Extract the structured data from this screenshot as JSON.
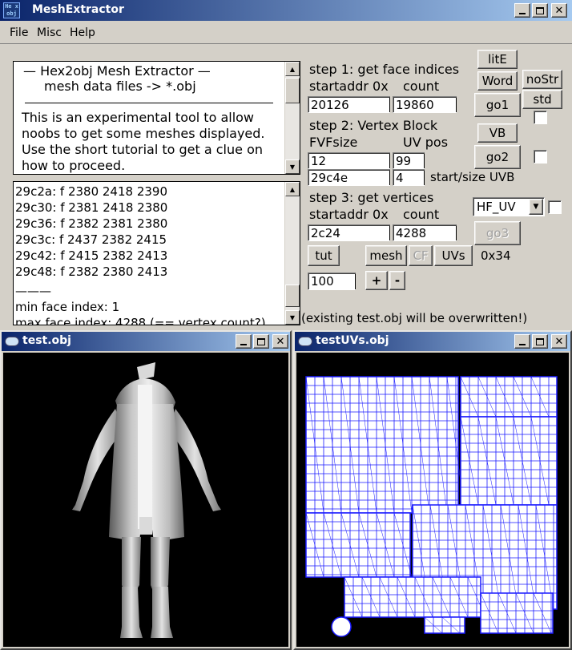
{
  "window": {
    "title": "MeshExtractor",
    "app_icon_text": "He x obj"
  },
  "menu": [
    "File",
    "Misc",
    "Help"
  ],
  "info_text": {
    "line1": "—   Hex2obj Mesh Extractor   —",
    "line2": "mesh data files -> *.obj",
    "para": [
      "This is an experimental tool to allow",
      "noobs to get some meshes displayed.",
      "Use the short tutorial to get a clue on",
      "how to proceed."
    ]
  },
  "log": {
    "lines": [
      "29c2a: f  2380 2418 2390",
      "29c30: f  2381 2418 2380",
      "29c36: f  2382 2381 2380",
      "29c3c: f  2437 2382 2415",
      "29c42: f  2415 2382 2413",
      "29c48: f  2382 2380 2413"
    ],
    "separator": "———",
    "summary": [
      "min face index: 1",
      "max face index: 4288 (== vertex count?)"
    ]
  },
  "step1": {
    "title": "step 1: get face indices",
    "addr_label": "startaddr 0x",
    "count_label": "count",
    "addr_value": "20126",
    "count_value": "19860"
  },
  "step2": {
    "title": "step 2: Vertex Block",
    "fvf_label": "FVFsize",
    "uv_label": "UV pos",
    "fvf_value": "12",
    "uv_value": "99",
    "uvb_start": "29c4e",
    "uvb_size": "4",
    "uvb_label": "start/size UVB"
  },
  "step3": {
    "title": "step 3: get vertices",
    "addr_label": "startaddr 0x",
    "count_label": "count",
    "addr_value": "2c24",
    "count_value": "4288"
  },
  "buttons": {
    "lite": "litE",
    "word": "Word",
    "nostr": "noStr",
    "go1": "go1",
    "std": "std",
    "vb": "VB",
    "go2": "go2",
    "go3": "go3",
    "tut": "tut",
    "mesh": "mesh",
    "cf": "CF",
    "uvs": "UVs",
    "plus": "+",
    "minus": "-"
  },
  "combo_value": "HF_UV",
  "hex_readout": "0x34",
  "zoom_value": "100",
  "warning": "(existing test.obj will be overwritten!)",
  "child_left": {
    "title": "test.obj"
  },
  "child_right": {
    "title": "testUVs.obj"
  },
  "colors": {
    "title_start": "#0a246a",
    "title_end": "#a6caf0",
    "uv_line": "#1a1aff"
  }
}
